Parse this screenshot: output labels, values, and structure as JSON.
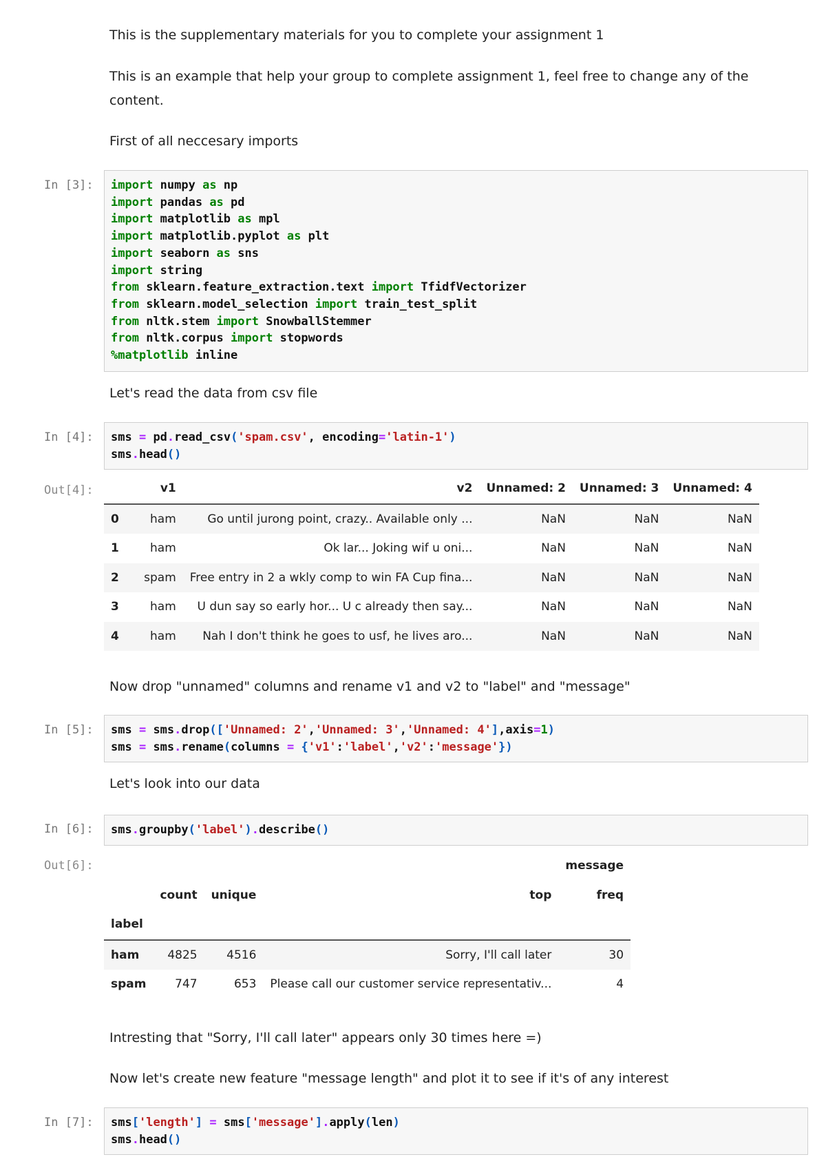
{
  "markdown": [
    "This is the supplementary materials for you to complete your assignment 1",
    "This is an example that help your group to complete assignment 1, feel free to change any of the",
    "content.",
    "First of all neccesary imports",
    "Let's read the data from csv file",
    "Now drop \"unnamed\" columns and rename v1 and v2 to \"label\" and \"message\"",
    "Let's look into our data",
    "Intresting that \"Sorry, I'll call later\" appears only 30 times here =)",
    "Now let's create new feature \"message length\" and plot it to see if it's of any interest"
  ],
  "prompts": {
    "in3": "In [3]:",
    "in4": "In [4]:",
    "out4": "Out[4]:",
    "in5": "In [5]:",
    "in6": "In [6]:",
    "out6": "Out[6]:",
    "in7": "In [7]:"
  },
  "code": {
    "cell3": [
      [
        [
          "kw",
          "import"
        ],
        [
          "t",
          " numpy "
        ],
        [
          "kw",
          "as"
        ],
        [
          "t",
          " np"
        ]
      ],
      [
        [
          "kw",
          "import"
        ],
        [
          "t",
          " pandas "
        ],
        [
          "kw",
          "as"
        ],
        [
          "t",
          " pd"
        ]
      ],
      [
        [
          "kw",
          "import"
        ],
        [
          "t",
          " matplotlib "
        ],
        [
          "kw",
          "as"
        ],
        [
          "t",
          " mpl"
        ]
      ],
      [
        [
          "kw",
          "import"
        ],
        [
          "t",
          " matplotlib.pyplot "
        ],
        [
          "kw",
          "as"
        ],
        [
          "t",
          " plt"
        ]
      ],
      [
        [
          "kw",
          "import"
        ],
        [
          "t",
          " seaborn "
        ],
        [
          "kw",
          "as"
        ],
        [
          "t",
          " sns"
        ]
      ],
      [
        [
          "kw",
          "import"
        ],
        [
          "t",
          " string"
        ]
      ],
      [
        [
          "kw",
          "from"
        ],
        [
          "t",
          " sklearn.feature_extraction.text "
        ],
        [
          "kw",
          "import"
        ],
        [
          "t",
          " TfidfVectorizer"
        ]
      ],
      [
        [
          "kw",
          "from"
        ],
        [
          "t",
          " sklearn.model_selection "
        ],
        [
          "kw",
          "import"
        ],
        [
          "t",
          " train_test_split"
        ]
      ],
      [
        [
          "kw",
          "from"
        ],
        [
          "t",
          " nltk.stem "
        ],
        [
          "kw",
          "import"
        ],
        [
          "t",
          " SnowballStemmer"
        ]
      ],
      [
        [
          "kw",
          "from"
        ],
        [
          "t",
          " nltk.corpus "
        ],
        [
          "kw",
          "import"
        ],
        [
          "t",
          " stopwords"
        ]
      ],
      [
        [
          "kw",
          "%matplotlib"
        ],
        [
          "t",
          " inline"
        ]
      ]
    ],
    "cell4": [
      [
        [
          "t",
          "sms "
        ],
        [
          "op",
          "="
        ],
        [
          "t",
          " pd"
        ],
        [
          "op",
          "."
        ],
        [
          "t",
          "read_csv"
        ],
        [
          "bl",
          "("
        ],
        [
          "str",
          "'spam.csv'"
        ],
        [
          "t",
          ", encoding"
        ],
        [
          "op",
          "="
        ],
        [
          "str",
          "'latin-1'"
        ],
        [
          "bl",
          ")"
        ]
      ],
      [
        [
          "t",
          "sms"
        ],
        [
          "op",
          "."
        ],
        [
          "t",
          "head"
        ],
        [
          "bl",
          "()"
        ]
      ]
    ],
    "cell5": [
      [
        [
          "t",
          "sms "
        ],
        [
          "op",
          "="
        ],
        [
          "t",
          " sms"
        ],
        [
          "op",
          "."
        ],
        [
          "t",
          "drop"
        ],
        [
          "bl",
          "(["
        ],
        [
          "str",
          "'Unnamed: 2'"
        ],
        [
          "t",
          ","
        ],
        [
          "str",
          "'Unnamed: 3'"
        ],
        [
          "t",
          ","
        ],
        [
          "str",
          "'Unnamed: 4'"
        ],
        [
          "bl",
          "]"
        ],
        [
          "t",
          ",axis"
        ],
        [
          "op",
          "="
        ],
        [
          "kw",
          "1"
        ],
        [
          "bl",
          ")"
        ]
      ],
      [
        [
          "t",
          "sms "
        ],
        [
          "op",
          "="
        ],
        [
          "t",
          " sms"
        ],
        [
          "op",
          "."
        ],
        [
          "t",
          "rename"
        ],
        [
          "bl",
          "("
        ],
        [
          "t",
          "columns "
        ],
        [
          "op",
          "="
        ],
        [
          "t",
          " "
        ],
        [
          "bl",
          "{"
        ],
        [
          "str",
          "'v1'"
        ],
        [
          "t",
          ":"
        ],
        [
          "str",
          "'label'"
        ],
        [
          "t",
          ","
        ],
        [
          "str",
          "'v2'"
        ],
        [
          "t",
          ":"
        ],
        [
          "str",
          "'message'"
        ],
        [
          "bl",
          "})"
        ]
      ]
    ],
    "cell6": [
      [
        [
          "t",
          "sms"
        ],
        [
          "op",
          "."
        ],
        [
          "t",
          "groupby"
        ],
        [
          "bl",
          "("
        ],
        [
          "str",
          "'label'"
        ],
        [
          "bl",
          ")"
        ],
        [
          "op",
          "."
        ],
        [
          "t",
          "describe"
        ],
        [
          "bl",
          "()"
        ]
      ]
    ],
    "cell7": [
      [
        [
          "t",
          "sms"
        ],
        [
          "bl",
          "["
        ],
        [
          "str",
          "'length'"
        ],
        [
          "bl",
          "]"
        ],
        [
          "t",
          " "
        ],
        [
          "op",
          "="
        ],
        [
          "t",
          " sms"
        ],
        [
          "bl",
          "["
        ],
        [
          "str",
          "'message'"
        ],
        [
          "bl",
          "]"
        ],
        [
          "op",
          "."
        ],
        [
          "t",
          "apply"
        ],
        [
          "bl",
          "("
        ],
        [
          "t",
          "len"
        ],
        [
          "bl",
          ")"
        ]
      ],
      [
        [
          "t",
          "sms"
        ],
        [
          "op",
          "."
        ],
        [
          "t",
          "head"
        ],
        [
          "bl",
          "()"
        ]
      ]
    ]
  },
  "table4": {
    "columns": [
      "v1",
      "v2",
      "Unnamed: 2",
      "Unnamed: 3",
      "Unnamed: 4"
    ],
    "rows": [
      {
        "idx": "0",
        "v1": "ham",
        "v2": "Go until jurong point, crazy.. Available only ...",
        "u2": "NaN",
        "u3": "NaN",
        "u4": "NaN"
      },
      {
        "idx": "1",
        "v1": "ham",
        "v2": "Ok lar... Joking wif u oni...",
        "u2": "NaN",
        "u3": "NaN",
        "u4": "NaN"
      },
      {
        "idx": "2",
        "v1": "spam",
        "v2": "Free entry in 2 a wkly comp to win FA Cup fina...",
        "u2": "NaN",
        "u3": "NaN",
        "u4": "NaN"
      },
      {
        "idx": "3",
        "v1": "ham",
        "v2": "U dun say so early hor... U c already then say...",
        "u2": "NaN",
        "u3": "NaN",
        "u4": "NaN"
      },
      {
        "idx": "4",
        "v1": "ham",
        "v2": "Nah I don't think he goes to usf, he lives aro...",
        "u2": "NaN",
        "u3": "NaN",
        "u4": "NaN"
      }
    ]
  },
  "table6": {
    "group_header": "message",
    "columns": [
      "count",
      "unique",
      "top",
      "freq"
    ],
    "index_name": "label",
    "rows": [
      {
        "label": "ham",
        "count": "4825",
        "unique": "4516",
        "top": "Sorry, I'll call later",
        "freq": "30"
      },
      {
        "label": "spam",
        "count": "747",
        "unique": "653",
        "top": "Please call our customer service representativ...",
        "freq": "4"
      }
    ]
  }
}
